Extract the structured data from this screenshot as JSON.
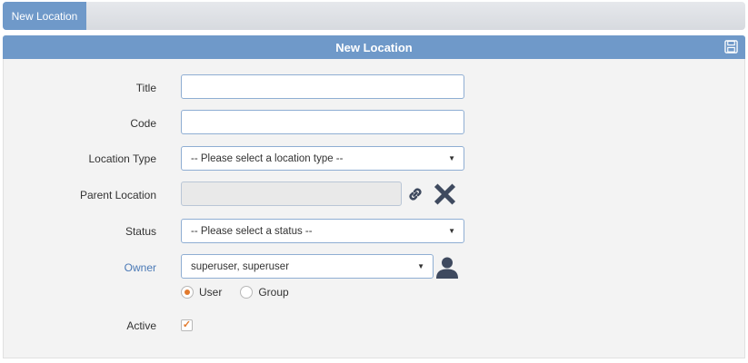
{
  "tabs": [
    {
      "label": "New Location"
    }
  ],
  "panel": {
    "title": "New Location",
    "save_icon": "floppy-disk-icon"
  },
  "form": {
    "title_label": "Title",
    "title_value": "",
    "code_label": "Code",
    "code_value": "",
    "location_type_label": "Location Type",
    "location_type_value": "-- Please select a location type --",
    "parent_location_label": "Parent Location",
    "parent_location_value": "",
    "status_label": "Status",
    "status_value": "-- Please select a status --",
    "owner_label": "Owner",
    "owner_value": "superuser, superuser",
    "owner_type_options": [
      {
        "label": "User",
        "checked": true
      },
      {
        "label": "Group",
        "checked": false
      }
    ],
    "active_label": "Active",
    "active_checked": true
  },
  "colors": {
    "accent": "#6f99c9",
    "check": "#e27a2d",
    "icon": "#3f4a5f"
  }
}
